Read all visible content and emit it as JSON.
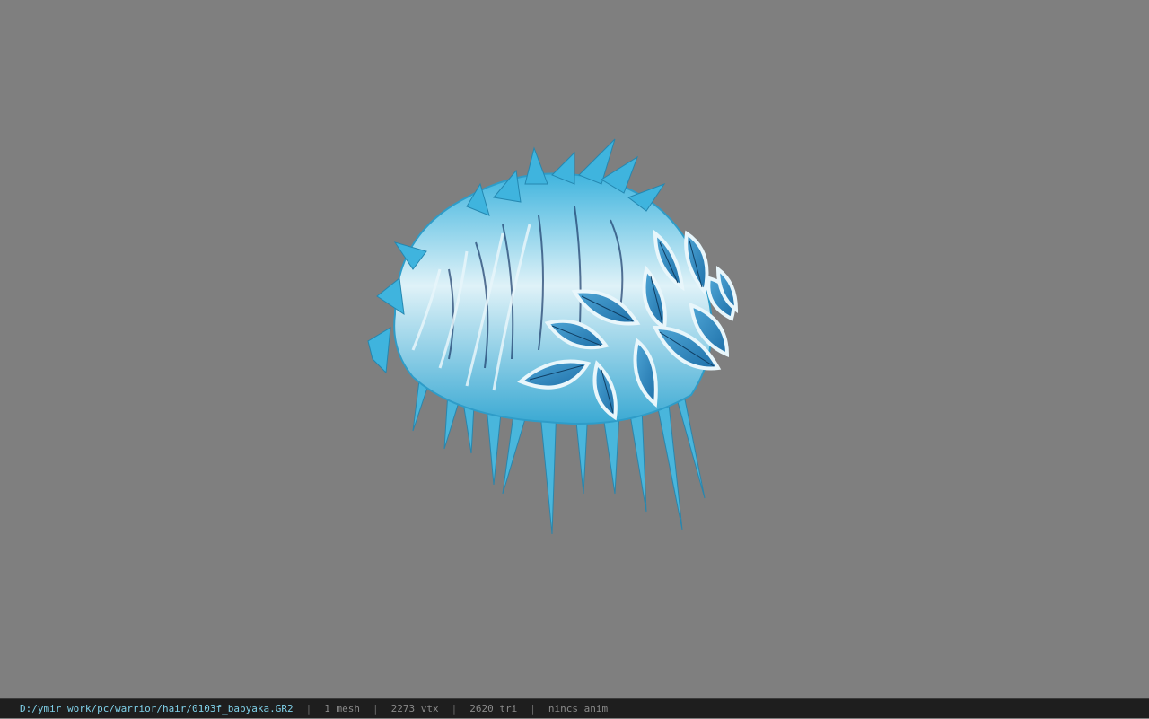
{
  "viewer": {
    "background_color": "#7f7f7f",
    "model_name": "hair mesh with blue flower ornament",
    "model_colors": {
      "hair": "#5fc7e6",
      "flower": "#2f86c2",
      "highlight": "#e8f6fb"
    }
  },
  "status": {
    "path": "D:/ymir work/pc/warrior/hair/0103f_babyaka.GR2",
    "sep": "|",
    "meshes": "1 mesh",
    "vertices": "2273 vtx",
    "triangles": "2620 tri",
    "anim": "nincs anim"
  }
}
